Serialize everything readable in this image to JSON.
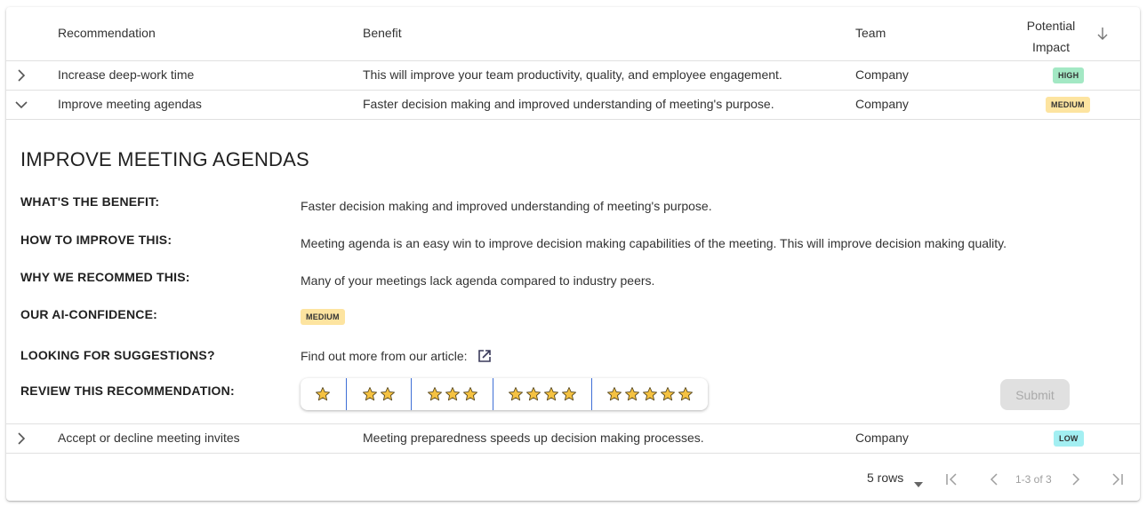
{
  "table": {
    "columns": [
      {
        "label": "Recommendation"
      },
      {
        "label": "Benefit"
      },
      {
        "label": "Team"
      },
      {
        "label": "Potential Impact",
        "sort": "descending",
        "sort_icon": "arrow-down-icon"
      }
    ],
    "rows": [
      {
        "expanded": false,
        "recommendation": "Increase deep-work time",
        "benefit": "This will improve your team productivity, quality, and employee engagement.",
        "team": "Company",
        "impact": "HIGH"
      },
      {
        "expanded": true,
        "recommendation": "Improve meeting agendas",
        "benefit": "Faster decision making and improved understanding of meeting's purpose.",
        "team": "Company",
        "impact": "MEDIUM"
      },
      {
        "expanded": false,
        "recommendation": "Accept or decline meeting invites",
        "benefit": "Meeting preparedness speeds up decision making processes.",
        "team": "Company",
        "impact": "LOW"
      }
    ]
  },
  "badge_colors": {
    "HIGH": "#a3e8c4",
    "MEDIUM": "#fde4a0",
    "LOW": "#a3eff2"
  },
  "detail": {
    "title": "IMPROVE MEETING AGENDAS",
    "fields": [
      {
        "label": "WHAT'S THE BENEFIT:",
        "value": "Faster decision making and improved understanding of meeting's purpose."
      },
      {
        "label": "HOW TO IMPROVE THIS:",
        "value": "Meeting agenda is an easy win to improve decision making capabilities of the meeting. This will improve decision making quality."
      },
      {
        "label": "WHY WE RECOMMED THIS:",
        "value": "Many of your meetings lack agenda compared to industry peers."
      },
      {
        "label": "OUR AI-CONFIDENCE:",
        "value": "MEDIUM"
      },
      {
        "label": "LOOKING FOR SUGGESTIONS?",
        "value": "Find out more from our article:",
        "icon": "external-link-icon"
      },
      {
        "label": "REVIEW THIS RECOMMENDATION:"
      }
    ],
    "rating_options": [
      1,
      2,
      3,
      4,
      5
    ],
    "submit_label": "Submit",
    "submit_enabled": false
  },
  "pagination": {
    "rows_per_page": "5 rows",
    "range_text": "1-3 of 3"
  },
  "colors": {
    "star_fill": "#f5c242",
    "rating_divider": "#3f6fd6"
  }
}
